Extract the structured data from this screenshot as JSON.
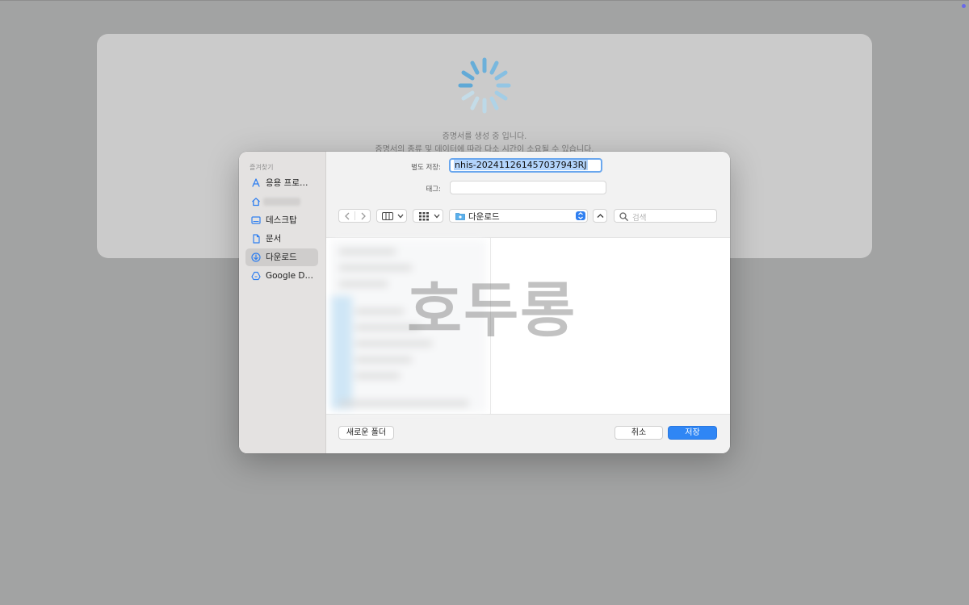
{
  "loading": {
    "line1": "증명서를 생성 중 입니다.",
    "line2": "증명서의 종류 및 데이터에 따라 다소 시간이 소요될 수 있습니다."
  },
  "dialog": {
    "sidebar": {
      "heading": "즐겨찾기",
      "items": [
        {
          "label": "응용 프로…",
          "icon": "applications-icon"
        },
        {
          "label": "",
          "icon": "home-icon"
        },
        {
          "label": "데스크탑",
          "icon": "desktop-icon"
        },
        {
          "label": "문서",
          "icon": "document-icon"
        },
        {
          "label": "다운로드",
          "icon": "downloads-icon",
          "active": true
        },
        {
          "label": "Google D…",
          "icon": "google-drive-icon"
        }
      ]
    },
    "save_as_label": "별도 저장:",
    "filename": "nhis-202411261457037943RJ",
    "tags_label": "태그:",
    "location": "다운로드",
    "search_placeholder": "검색",
    "watermark": "호두롱",
    "new_folder_label": "새로운 폴더",
    "cancel_label": "취소",
    "save_label": "저장"
  },
  "colors": {
    "accent": "#2f86f5",
    "selection": "#b3d4fb",
    "sidebar_bg": "#e4e2e1",
    "page_bg": "#a2a3a3"
  }
}
